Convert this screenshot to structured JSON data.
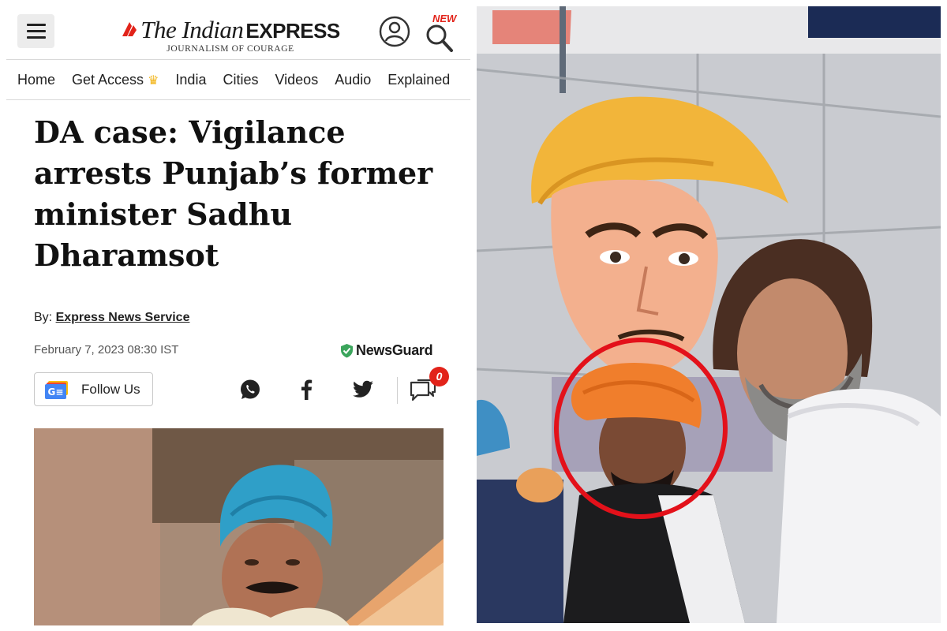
{
  "header": {
    "logo": {
      "the_indian": "The Indian",
      "express": "EXPRESS",
      "tagline": "JOURNALISM OF COURAGE"
    },
    "new_badge": "NEW",
    "icons": {
      "menu": "hamburger-menu-icon",
      "account": "user-account-icon",
      "search": "search-icon",
      "flame": "flame-logo-icon"
    }
  },
  "nav": {
    "items": [
      "Home",
      "Get Access",
      "India",
      "Cities",
      "Videos",
      "Audio",
      "Explained"
    ],
    "get_access_icon": "crown-icon"
  },
  "article": {
    "headline": "DA case: Vigilance arrests Punjab’s former minister Sadhu Dharamsot",
    "by_label": "By:",
    "author": "Express News Service",
    "date": "February 7, 2023 08:30 IST",
    "newsguard": "NewsGuard",
    "follow_label": "Follow Us",
    "comment_count": "0",
    "share_icons": [
      "whatsapp-icon",
      "facebook-icon",
      "twitter-icon",
      "comment-icon"
    ]
  },
  "colors": {
    "brand_red": "#e2231a",
    "newsguard_green": "#3ba55c",
    "highlight_circle": "#e3111a",
    "headline_text": "#111111"
  }
}
